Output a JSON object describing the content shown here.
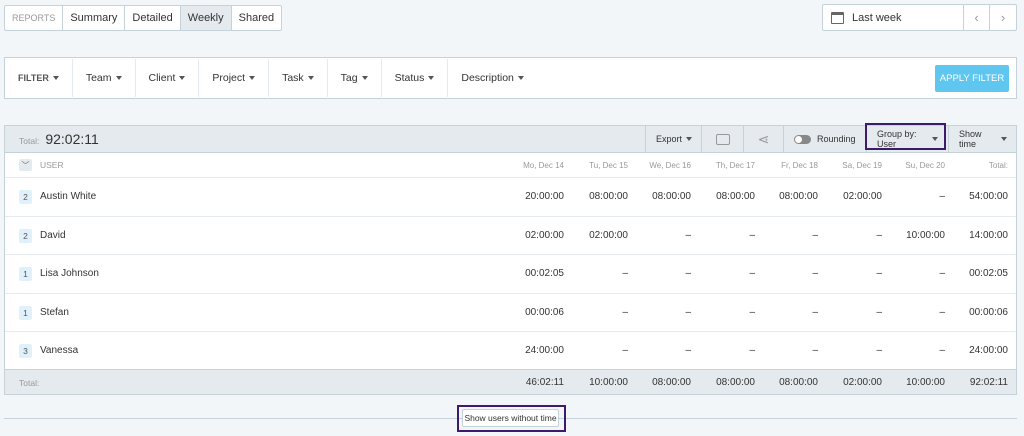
{
  "tabs": [
    "REPORTS",
    "Summary",
    "Detailed",
    "Weekly",
    "Shared"
  ],
  "active_tab": "Weekly",
  "date_range": {
    "label": "Last week",
    "prev": "‹",
    "next": "›"
  },
  "filters": [
    "FILTER",
    "Team",
    "Client",
    "Project",
    "Task",
    "Tag",
    "Status",
    "Description"
  ],
  "apply_filter": "APPLY FILTER",
  "report": {
    "total_label": "Total:",
    "total_value": "92:02:11",
    "export": "Export",
    "rounding": "Rounding",
    "group_by": "Group by: User",
    "show_time": "Show time",
    "user_header": "USER",
    "days": [
      "Mo, Dec 14",
      "Tu, Dec 15",
      "We, Dec 16",
      "Th, Dec 17",
      "Fr, Dec 18",
      "Sa, Dec 19",
      "Su, Dec 20",
      "Total:"
    ],
    "rows": [
      {
        "count": "2",
        "name": "Austin White",
        "values": [
          "20:00:00",
          "08:00:00",
          "08:00:00",
          "08:00:00",
          "08:00:00",
          "02:00:00",
          "–",
          "54:00:00"
        ]
      },
      {
        "count": "2",
        "name": "David",
        "values": [
          "02:00:00",
          "02:00:00",
          "–",
          "–",
          "–",
          "–",
          "10:00:00",
          "14:00:00"
        ]
      },
      {
        "count": "1",
        "name": "Lisa Johnson",
        "values": [
          "00:02:05",
          "–",
          "–",
          "–",
          "–",
          "–",
          "–",
          "00:02:05"
        ]
      },
      {
        "count": "1",
        "name": "Stefan",
        "values": [
          "00:00:06",
          "–",
          "–",
          "–",
          "–",
          "–",
          "–",
          "00:00:06"
        ]
      },
      {
        "count": "3",
        "name": "Vanessa",
        "values": [
          "24:00:00",
          "–",
          "–",
          "–",
          "–",
          "–",
          "–",
          "24:00:00"
        ]
      }
    ],
    "totals_label": "Total:",
    "totals": [
      "46:02:11",
      "10:00:00",
      "08:00:00",
      "08:00:00",
      "08:00:00",
      "02:00:00",
      "10:00:00",
      "92:02:11"
    ]
  },
  "show_users_without_time": "Show users without time",
  "colors": {
    "accent": "#5fc6f0",
    "highlight": "#3d1a6e"
  }
}
